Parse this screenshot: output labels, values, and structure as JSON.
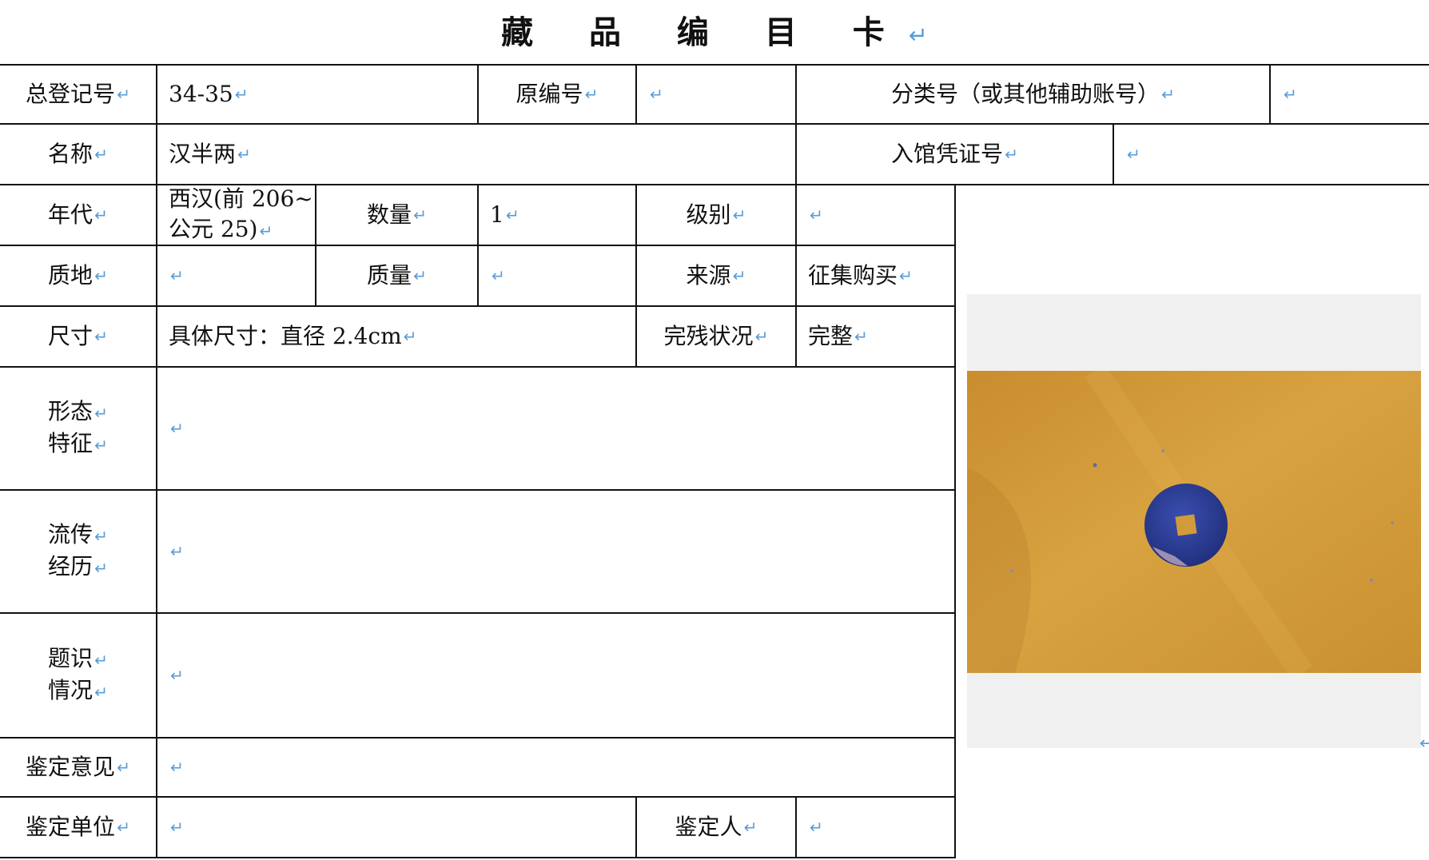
{
  "title": "藏 品 编 目 卡",
  "return_mark": "↵",
  "rows": {
    "r1": {
      "reg_label": "总登记号",
      "reg_value": "34-35",
      "orig_label": "原编号",
      "orig_value": "",
      "class_label": "分类号（或其他辅助账号）",
      "class_value": ""
    },
    "r2": {
      "name_label": "名称",
      "name_value": "汉半两",
      "entry_label": "入馆凭证号",
      "entry_value": ""
    },
    "r3": {
      "era_label": "年代",
      "era_value_line1": "西汉(前 206~",
      "era_value_line2": "公元 25)",
      "qty_label": "数量",
      "qty_value": "1",
      "grade_label": "级别",
      "grade_value": ""
    },
    "r4": {
      "material_label": "质地",
      "material_value": "",
      "mass_label": "质量",
      "mass_value": "",
      "source_label": "来源",
      "source_value": "征集购买"
    },
    "r5": {
      "size_label": "尺寸",
      "size_value": "具体尺寸：直径 2.4cm",
      "condition_label": "完残状况",
      "condition_value": "完整"
    },
    "r6": {
      "label_line1": "形态",
      "label_line2": "特征",
      "value": ""
    },
    "r7": {
      "label_line1": "流传",
      "label_line2": "经历",
      "value": ""
    },
    "r8": {
      "label_line1": "题识",
      "label_line2": "情况",
      "value": ""
    },
    "r9": {
      "label": "鉴定意见",
      "value": ""
    },
    "r10": {
      "unit_label": "鉴定单位",
      "unit_value": "",
      "person_label": "鉴定人",
      "person_value": ""
    }
  },
  "photo": {
    "subject": "coin-photo",
    "background_color": "#d39a3a",
    "coin_color": "#2c3f9a"
  }
}
